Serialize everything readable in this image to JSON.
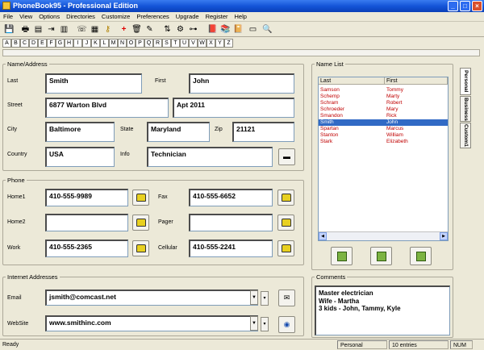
{
  "window": {
    "title": "PhoneBook95 - Professional Edition"
  },
  "menu": [
    "File",
    "View",
    "Options",
    "Directories",
    "Customize",
    "Preferences",
    "Upgrade",
    "Register",
    "Help"
  ],
  "alphabet": [
    "A",
    "B",
    "C",
    "D",
    "E",
    "F",
    "G",
    "H",
    "I",
    "J",
    "K",
    "L",
    "M",
    "N",
    "O",
    "P",
    "Q",
    "R",
    "S",
    "T",
    "U",
    "V",
    "W",
    "X",
    "Y",
    "Z"
  ],
  "name_address": {
    "legend": "Name/Address",
    "last_label": "Last",
    "last": "Smith",
    "first_label": "First",
    "first": "John",
    "street_label": "Street",
    "street1": "6877 Warton Blvd",
    "street2": "Apt 2011",
    "city_label": "City",
    "city": "Baltimore",
    "state_label": "State",
    "state": "Maryland",
    "zip_label": "Zip",
    "zip": "21121",
    "country_label": "Country",
    "country": "USA",
    "info_label": "Info",
    "info": "Technician"
  },
  "phone": {
    "legend": "Phone",
    "home1_label": "Home1",
    "home1": "410-555-9989",
    "fax_label": "Fax",
    "fax": "410-555-6652",
    "home2_label": "Home2",
    "home2": "",
    "pager_label": "Pager",
    "pager": "",
    "work_label": "Work",
    "work": "410-555-2365",
    "cellular_label": "Cellular",
    "cellular": "410-555-2241"
  },
  "internet": {
    "legend": "Internet Addresses",
    "email_label": "Email",
    "email": "jsmith@comcast.net",
    "website_label": "WebSite",
    "website": "www.smithinc.com"
  },
  "name_list": {
    "legend": "Name List",
    "col_last": "Last",
    "col_first": "First",
    "rows": [
      {
        "last": "Samson",
        "first": "Tommy"
      },
      {
        "last": "Schemp",
        "first": "Marty"
      },
      {
        "last": "Schram",
        "first": "Robert"
      },
      {
        "last": "Schroeder",
        "first": "Mary"
      },
      {
        "last": "Smandon",
        "first": "Rick"
      },
      {
        "last": "Smith",
        "first": "John"
      },
      {
        "last": "Spartan",
        "first": "Marcus"
      },
      {
        "last": "Stanton",
        "first": "William"
      },
      {
        "last": "Stark",
        "first": "Elizabeth"
      }
    ],
    "selected_index": 5
  },
  "tabs": [
    "Personal",
    "Business",
    "Custom1"
  ],
  "comments": {
    "legend": "Comments",
    "lines": [
      "Master electrician",
      "Wife - Martha",
      "3 kids - John, Tammy, Kyle"
    ]
  },
  "status": {
    "ready": "Ready",
    "mode": "Personal",
    "count": "10 entries",
    "numlock": "NUM"
  },
  "colors": {
    "title_bar": "#1455d8",
    "selection": "#316ac5",
    "list_text": "#c00000"
  }
}
